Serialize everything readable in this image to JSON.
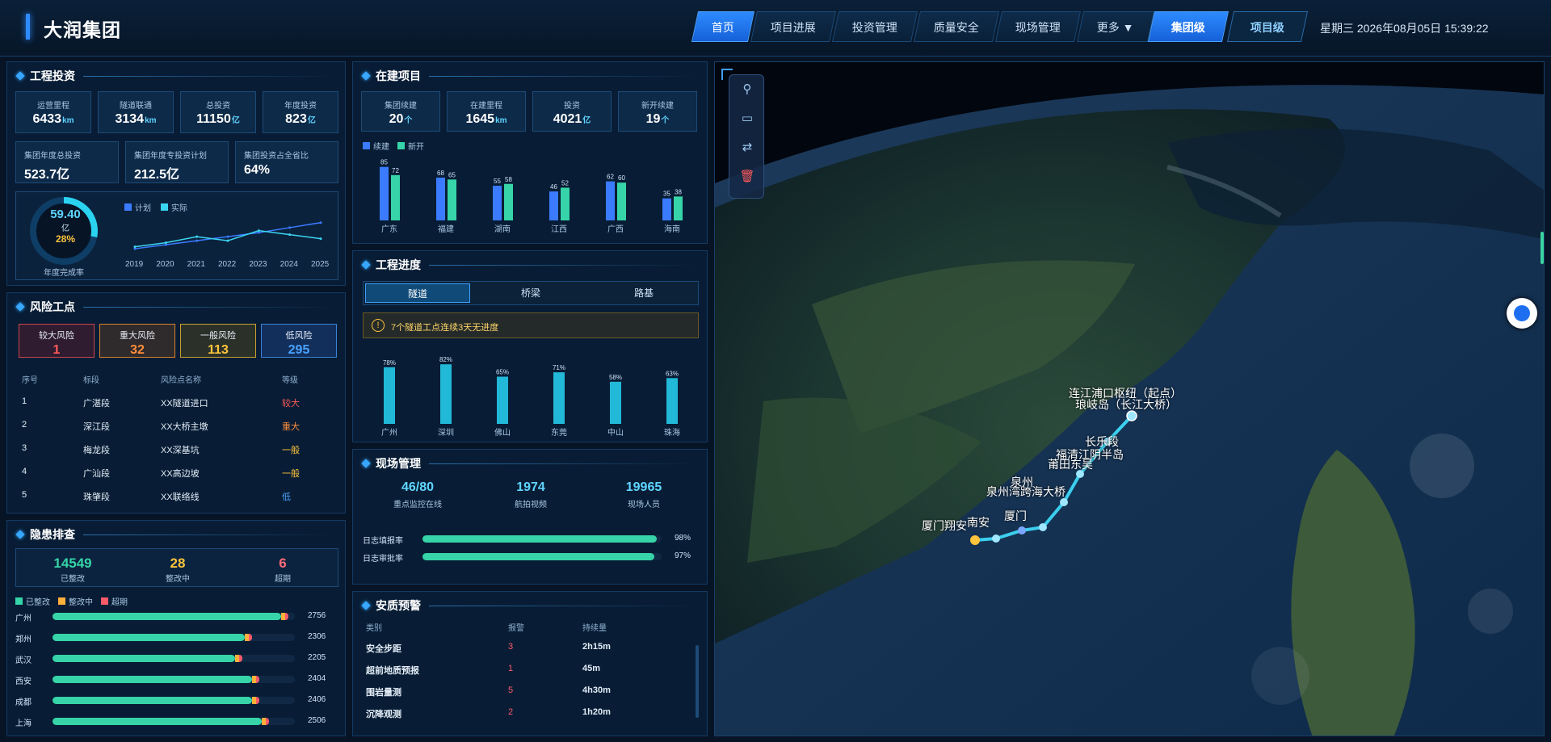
{
  "header": {
    "brand": "大润集团",
    "nav": [
      "首页",
      "项目进展",
      "投资管理",
      "质量安全",
      "现场管理",
      "更多 ▼"
    ],
    "levels": [
      "集团级",
      "项目级"
    ],
    "datetime": "星期三 2026年08月05日 15:39:22"
  },
  "investment": {
    "title": "工程投资",
    "stats": [
      {
        "label": "运营里程",
        "value": "6433",
        "unit": "km"
      },
      {
        "label": "隧道联通",
        "value": "3134",
        "unit": "km"
      },
      {
        "label": "总投资",
        "value": "11150",
        "unit": "亿"
      },
      {
        "label": "年度投资",
        "value": "823",
        "unit": "亿"
      }
    ],
    "stats2": [
      {
        "label": "集团年度总投资",
        "value": "523.7亿"
      },
      {
        "label": "集团年度专投资计划",
        "value": "212.5亿"
      },
      {
        "label": "集团投资占全省比",
        "value": "64%"
      }
    ],
    "ring": {
      "value": "59.40",
      "unit": "亿",
      "pct": "28%",
      "caption": "年度完成率",
      "fraction": 0.28
    },
    "legend": [
      "计划",
      "实际"
    ],
    "years": [
      "2019",
      "2020",
      "2021",
      "2022",
      "2023",
      "2024",
      "2025"
    ]
  },
  "chart_data": [
    {
      "type": "line",
      "series": [
        {
          "name": "计划",
          "values": [
            12,
            16,
            20,
            24,
            28,
            33,
            38
          ]
        },
        {
          "name": "实际",
          "values": [
            14,
            18,
            24,
            20,
            30,
            26,
            22
          ]
        }
      ],
      "x": [
        "2019",
        "2020",
        "2021",
        "2022",
        "2023",
        "2024",
        "2025"
      ]
    },
    {
      "type": "bar",
      "categories": [
        "广东",
        "福建",
        "湖南",
        "江西",
        "广西",
        "海南"
      ],
      "series": [
        {
          "name": "续建",
          "values": [
            85,
            68,
            55,
            46,
            62,
            35
          ]
        },
        {
          "name": "新开",
          "values": [
            72,
            65,
            58,
            52,
            60,
            38
          ]
        }
      ]
    },
    {
      "type": "bar",
      "categories": [
        "广州",
        "深圳",
        "佛山",
        "东莞",
        "中山",
        "珠海"
      ],
      "values": [
        78,
        82,
        65,
        71,
        58,
        63
      ]
    }
  ],
  "construction": {
    "title": "在建项目",
    "stats": [
      {
        "label": "集团续建",
        "value": "20",
        "unit": "个"
      },
      {
        "label": "在建里程",
        "value": "1645",
        "unit": "km"
      },
      {
        "label": "投资",
        "value": "4021",
        "unit": "亿"
      },
      {
        "label": "新开续建",
        "value": "19",
        "unit": "个"
      }
    ],
    "legend": [
      "续建",
      "新开"
    ],
    "labels": [
      "85",
      "72",
      "68",
      "65",
      "55",
      "58",
      "46",
      "52",
      "62",
      "60",
      "35",
      "38"
    ]
  },
  "progress": {
    "title": "工程进度",
    "tabs": [
      "隧道",
      "桥梁",
      "路基"
    ],
    "alert": "7个隧道工点连续3天无进度",
    "labels": [
      "78%",
      "82%",
      "65%",
      "71%",
      "58%",
      "63%"
    ]
  },
  "site": {
    "title": "现场管理",
    "stats": [
      {
        "value": "46/80",
        "label": "重点监控在线"
      },
      {
        "value": "1974",
        "label": "航拍视频"
      },
      {
        "value": "19965",
        "label": "现场人员"
      }
    ],
    "bars": [
      {
        "label": "日志填报率",
        "value": "98%",
        "fraction": 0.98
      },
      {
        "label": "日志审批率",
        "value": "97%",
        "fraction": 0.97
      }
    ]
  },
  "warning": {
    "title": "安质预警",
    "headers": [
      "类别",
      "报警",
      "持续量"
    ],
    "rows": [
      [
        "安全步距",
        "3",
        "2h15m"
      ],
      [
        "超前地质预报",
        "1",
        "45m"
      ],
      [
        "围岩量测",
        "5",
        "4h30m"
      ],
      [
        "沉降观测",
        "2",
        "1h20m"
      ]
    ]
  },
  "risk": {
    "title": "风险工点",
    "cards": [
      {
        "label": "较大风险",
        "value": "1"
      },
      {
        "label": "重大风险",
        "value": "32"
      },
      {
        "label": "一般风险",
        "value": "113"
      },
      {
        "label": "低风险",
        "value": "295"
      }
    ],
    "headers": [
      "序号",
      "标段",
      "风险点名称",
      "等级"
    ],
    "rows": [
      [
        "1",
        "广湛段",
        "XX隧道进口",
        "较大"
      ],
      [
        "2",
        "深江段",
        "XX大桥主墩",
        "重大"
      ],
      [
        "3",
        "梅龙段",
        "XX深基坑",
        "一般"
      ],
      [
        "4",
        "广汕段",
        "XX高边坡",
        "一般"
      ],
      [
        "5",
        "珠肇段",
        "XX联络线",
        "低"
      ]
    ]
  },
  "hazard": {
    "title": "隐患排查",
    "stats": [
      {
        "value": "14549",
        "label": "已整改"
      },
      {
        "value": "28",
        "label": "整改中"
      },
      {
        "value": "6",
        "label": "超期"
      }
    ],
    "legend": [
      "已整改",
      "整改中",
      "超期"
    ],
    "rows": [
      {
        "city": "广州",
        "total": "2756",
        "fraction": 0.97
      },
      {
        "city": "郑州",
        "total": "2306",
        "fraction": 0.82
      },
      {
        "city": "武汉",
        "total": "2205",
        "fraction": 0.78
      },
      {
        "city": "西安",
        "total": "2404",
        "fraction": 0.85
      },
      {
        "city": "成都",
        "total": "2406",
        "fraction": 0.85
      },
      {
        "city": "上海",
        "total": "2506",
        "fraction": 0.89
      }
    ]
  },
  "map": {
    "labels": [
      "连江浦口枢纽（起点）",
      "琅岐岛（长江大桥）",
      "长乐段",
      "福清江阴半岛",
      "莆田东吴",
      "泉州湾跨海大桥",
      "泉州",
      "厦门翔安",
      "南安",
      "厦门"
    ]
  }
}
